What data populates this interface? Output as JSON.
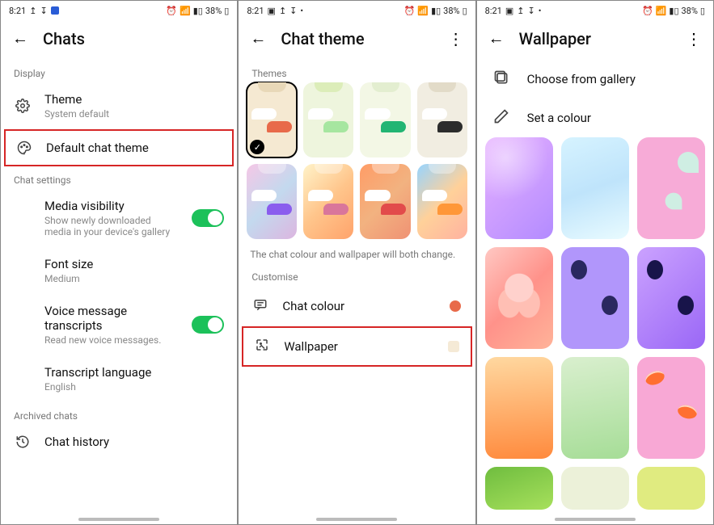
{
  "status": {
    "time": "8:21",
    "battery": "38%"
  },
  "screen1": {
    "title": "Chats",
    "sections": {
      "display": "Display",
      "chat_settings": "Chat settings",
      "archived": "Archived chats"
    },
    "rows": {
      "theme": {
        "title": "Theme",
        "sub": "System default"
      },
      "default_theme": {
        "title": "Default chat theme"
      },
      "media": {
        "title": "Media visibility",
        "sub": "Show newly downloaded media in your device's gallery"
      },
      "font": {
        "title": "Font size",
        "sub": "Medium"
      },
      "voice": {
        "title": "Voice message transcripts",
        "sub": "Read new voice messages."
      },
      "trans_lang": {
        "title": "Transcript language",
        "sub": "English"
      },
      "history": {
        "title": "Chat history"
      }
    }
  },
  "screen2": {
    "title": "Chat theme",
    "section_themes": "Themes",
    "help": "The chat colour and wallpaper will both change.",
    "section_customise": "Customise",
    "chat_colour": "Chat colour",
    "wallpaper": "Wallpaper",
    "chat_colour_preview": "#e86a4a",
    "wallpaper_preview": "#f5ead6",
    "swatches": [
      {
        "bg": "#f5e9d2",
        "notch": "#e8d8b8",
        "bubble": "#e86a4a",
        "selected": true
      },
      {
        "bg": "#eef5dd",
        "notch": "#dcedb9",
        "bubble": "#a6e6a0"
      },
      {
        "bg": "#f3f7e5",
        "notch": "#e3eed0",
        "bubble": "#22b573"
      },
      {
        "bg": "#f1ede1",
        "notch": "#e2dbc8",
        "bubble": "#2c2c2c"
      }
    ],
    "swatches2": [
      {
        "cls": "grad1",
        "bubble": "#8a5dee"
      },
      {
        "cls": "grad2",
        "bubble": "#d9769b"
      },
      {
        "cls": "grad3",
        "bubble": "#e24b4b"
      },
      {
        "cls": "grad4",
        "bubble": "#ff9738"
      }
    ]
  },
  "screen3": {
    "title": "Wallpaper",
    "gallery": "Choose from gallery",
    "set_colour": "Set a colour"
  }
}
